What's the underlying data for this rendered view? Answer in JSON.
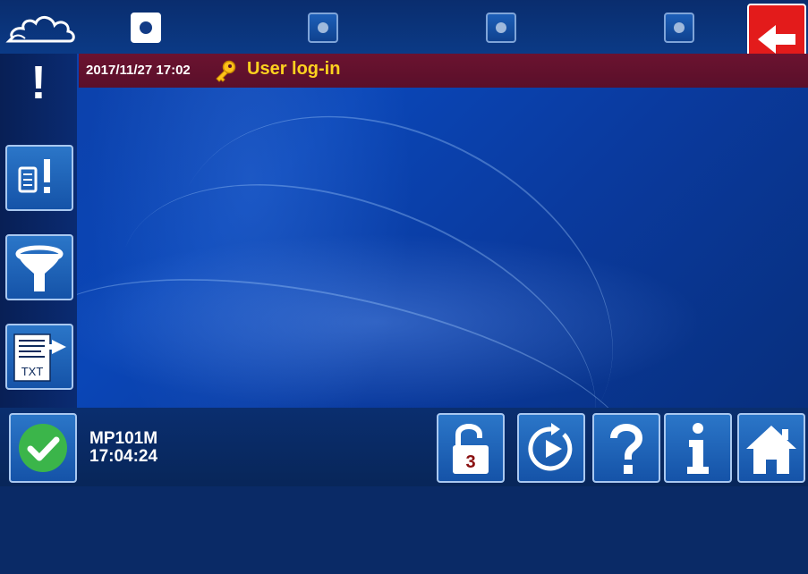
{
  "pager": {
    "pages": [
      {
        "name": "page-1",
        "active": true
      },
      {
        "name": "page-2",
        "active": false
      },
      {
        "name": "page-3",
        "active": false
      },
      {
        "name": "page-4",
        "active": false
      }
    ]
  },
  "banner": {
    "timestamp": "2017/11/27 17:02",
    "message": "User log-in",
    "icon": "key-icon"
  },
  "alert": {
    "symbol": "!"
  },
  "side_buttons": [
    {
      "icon": "event-list-icon"
    },
    {
      "icon": "filter-icon"
    },
    {
      "icon": "export-txt-icon",
      "label": "TXT"
    }
  ],
  "status": {
    "device": "MP101M",
    "time": "17:04:24"
  },
  "bottom_buttons": {
    "unlock_level": "3",
    "icons": [
      "unlock-icon",
      "replay-icon",
      "help-icon",
      "info-icon",
      "home-icon"
    ]
  },
  "colors": {
    "banner_text": "#ffd21f",
    "banner_bg": "#5a0f2a",
    "back_button": "#e31b1b",
    "ok_check": "#3bb54a"
  }
}
